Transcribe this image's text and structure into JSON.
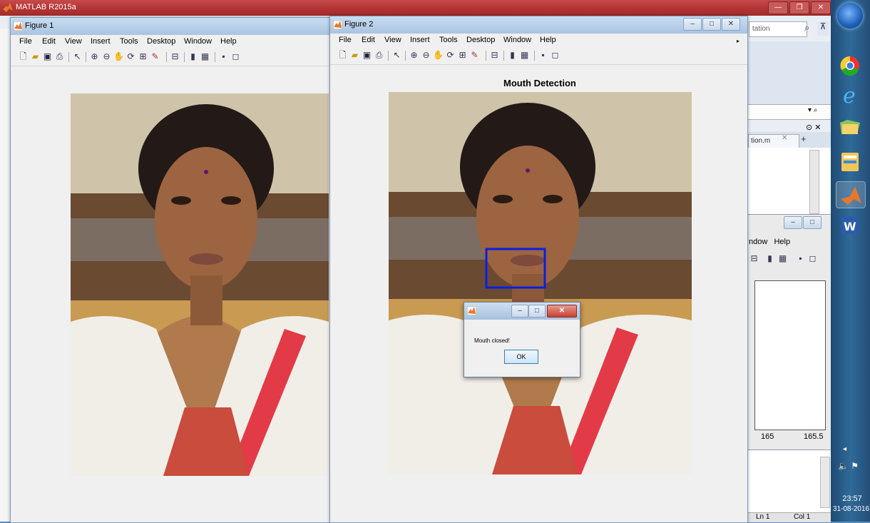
{
  "matlab": {
    "title": "MATLAB R2015a",
    "search_placeholder": "tation",
    "editor_tab": "tion.m",
    "figure3_menu": [
      "ndow",
      "Help"
    ],
    "figure3_ticks": [
      "165",
      "165.5"
    ],
    "status_ln": "Ln 1",
    "status_col": "Col 1"
  },
  "figure1": {
    "title": "Figure 1",
    "menu": [
      "File",
      "Edit",
      "View",
      "Insert",
      "Tools",
      "Desktop",
      "Window",
      "Help"
    ]
  },
  "figure2": {
    "title": "Figure 2",
    "menu": [
      "File",
      "Edit",
      "View",
      "Insert",
      "Tools",
      "Desktop",
      "Window",
      "Help"
    ],
    "heading": "Mouth Detection",
    "detection_box_color": "#0a1fe0"
  },
  "dialog": {
    "message": "Mouth closed!",
    "ok_label": "OK"
  },
  "taskbar": {
    "time": "23:57",
    "date": "31-08-2016",
    "apps": [
      "windows-start",
      "chrome",
      "internet-explorer",
      "folder",
      "file-explorer",
      "matlab",
      "word"
    ]
  },
  "colors": {
    "matlab_titlebar": "#b33636",
    "taskbar": "#2f6a98",
    "window_chrome": "#a9c4e2"
  }
}
